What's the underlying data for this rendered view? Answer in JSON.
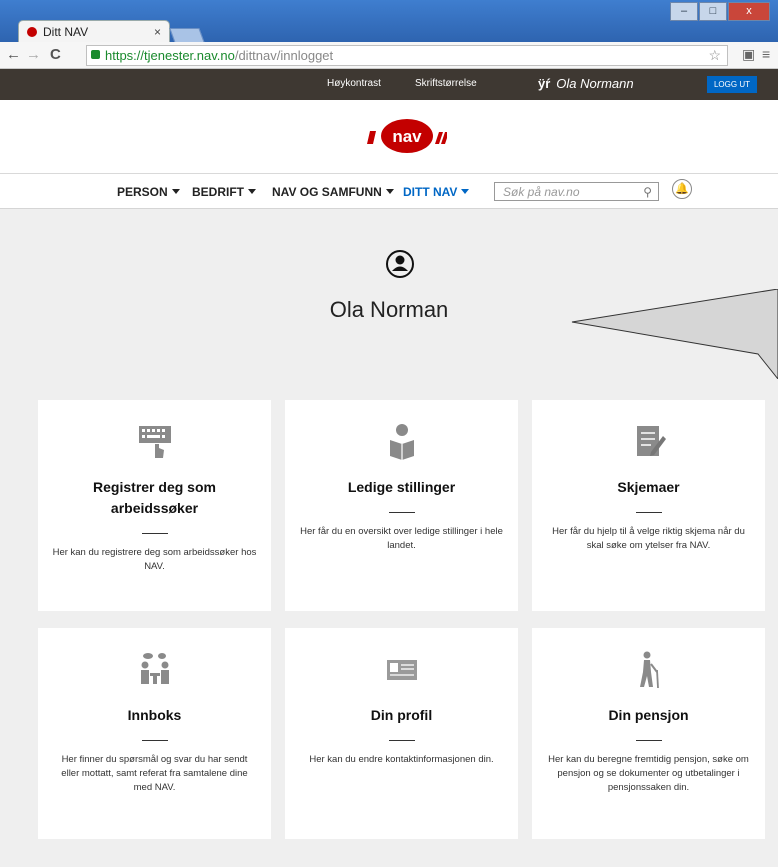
{
  "browser": {
    "tab_title": "Ditt NAV",
    "tab_close": "×",
    "url_host": "https://tjenester.nav.no",
    "url_path": "/dittnav/innlogget"
  },
  "topbar": {
    "highcontrast": "Høykontrast",
    "fontsize": "Skriftstørrelse",
    "user": "Ola Normann",
    "logout": "LOGG UT"
  },
  "logo_text": "nav",
  "menu": {
    "items": [
      {
        "label": "PERSON"
      },
      {
        "label": "BEDRIFT"
      },
      {
        "label": "NAV OG SAMFUNN"
      },
      {
        "label": "DITT NAV"
      }
    ],
    "search_placeholder": "Søk på nav.no"
  },
  "profile": {
    "name": "Ola Norman"
  },
  "cards": [
    {
      "title": "Registrer deg som arbeidssøker",
      "text": "Her kan du registrere deg som arbeidssøker hos NAV.",
      "icon": "keyboard-icon"
    },
    {
      "title": "Ledige stillinger",
      "text": "Her får du en oversikt over ledige stillinger i hele landet.",
      "icon": "newspaper-reader-icon"
    },
    {
      "title": "Skjemaer",
      "text": "Her får du hjelp til å velge riktig skjema når du skal søke om ytelser fra NAV.",
      "icon": "form-pencil-icon"
    },
    {
      "title": "Innboks",
      "text": "Her finner du spørsmål og svar du har sendt eller mottatt, samt referat fra samtalene dine med NAV.",
      "icon": "meeting-icon"
    },
    {
      "title": "Din profil",
      "text": "Her kan du endre kontaktinformasjonen din.",
      "icon": "id-card-icon"
    },
    {
      "title": "Din pensjon",
      "text": "Her kan du beregne fremtidig pensjon, søke om pensjon og se dokumenter og utbetalinger i pensjonssaken din.",
      "icon": "elderly-person-icon"
    }
  ],
  "colors": {
    "brand_red": "#c30000",
    "link_blue": "#0067c5",
    "top_bar": "#3e3832",
    "page_bg": "#efefef"
  }
}
